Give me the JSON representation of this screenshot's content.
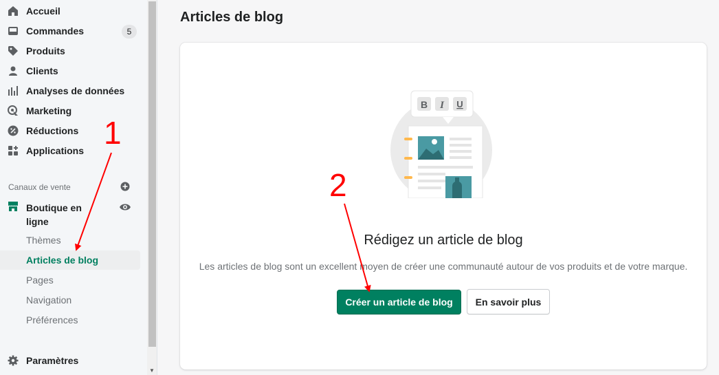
{
  "sidebar": {
    "items": [
      {
        "label": "Accueil",
        "icon": "home-icon"
      },
      {
        "label": "Commandes",
        "icon": "orders-icon",
        "badge": "5"
      },
      {
        "label": "Produits",
        "icon": "tag-icon"
      },
      {
        "label": "Clients",
        "icon": "person-icon"
      },
      {
        "label": "Analyses de données",
        "icon": "analytics-icon"
      },
      {
        "label": "Marketing",
        "icon": "marketing-icon"
      },
      {
        "label": "Réductions",
        "icon": "discount-icon"
      },
      {
        "label": "Applications",
        "icon": "apps-icon"
      }
    ],
    "sales_channels_label": "Canaux de vente",
    "store": {
      "label": "Boutique en ligne",
      "icon": "store-icon"
    },
    "sub_items": [
      {
        "label": "Thèmes"
      },
      {
        "label": "Articles de blog",
        "active": true
      },
      {
        "label": "Pages"
      },
      {
        "label": "Navigation"
      },
      {
        "label": "Préférences"
      }
    ],
    "settings": {
      "label": "Paramètres",
      "icon": "gear-icon"
    }
  },
  "main": {
    "title": "Articles de blog",
    "empty_state": {
      "heading": "Rédigez un article de blog",
      "body": "Les articles de blog sont un excellent moyen de créer une communauté autour de vos produits et de votre marque.",
      "primary_button": "Créer un article de blog",
      "secondary_button": "En savoir plus"
    }
  },
  "annotations": {
    "step1": "1",
    "step2": "2"
  },
  "colors": {
    "accent": "#008060",
    "active_text": "#007f5f",
    "annotation": "#ff0000"
  }
}
